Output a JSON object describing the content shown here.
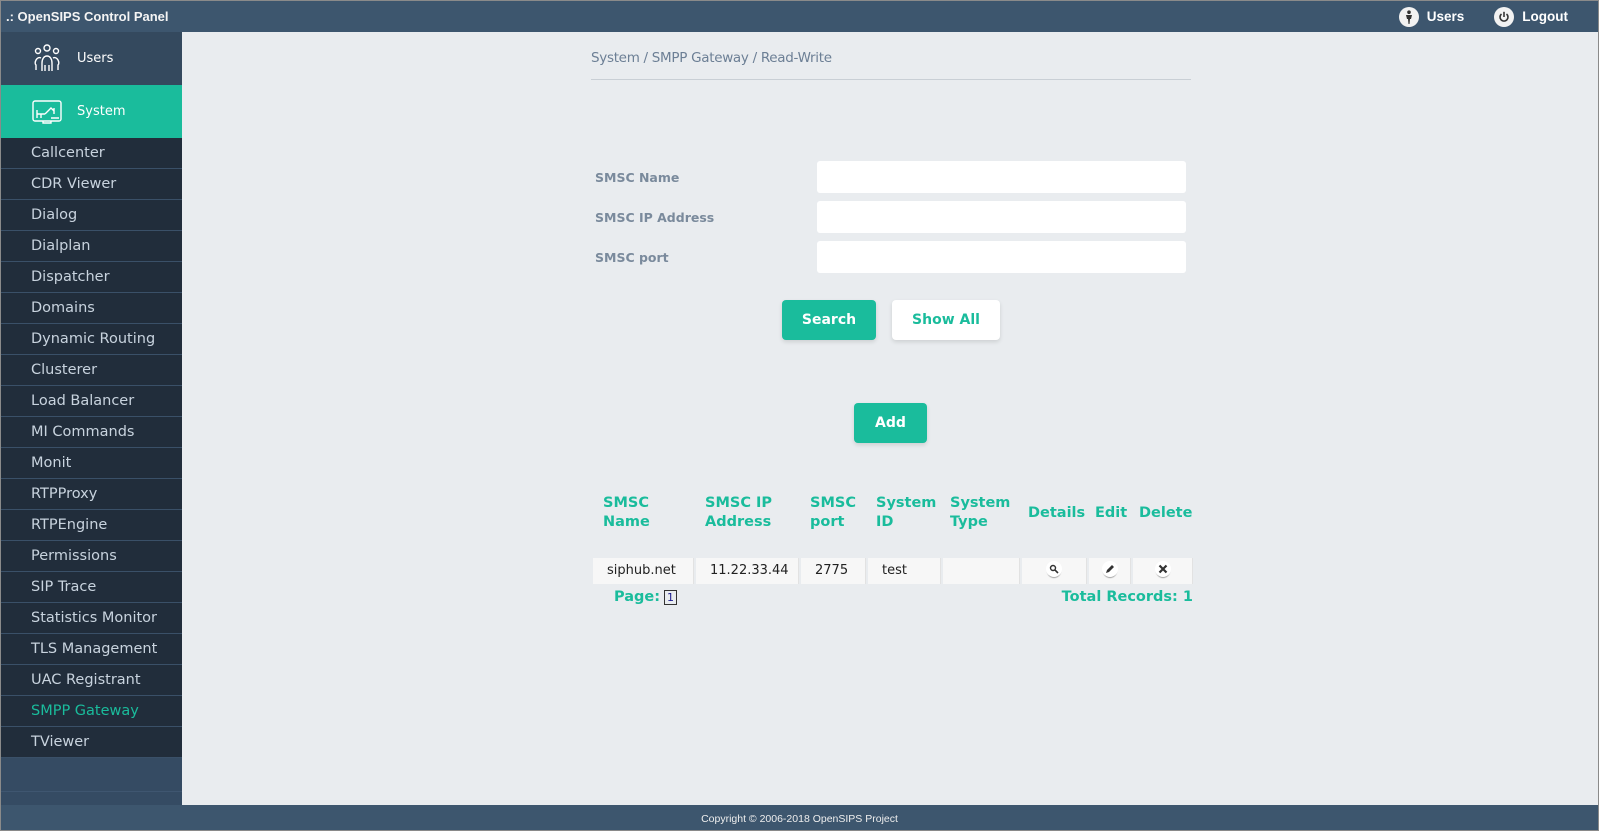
{
  "app": {
    "title": ".: OpenSIPS Control Panel",
    "top_links": [
      {
        "label": "Users",
        "icon": "person-icon"
      },
      {
        "label": "Logout",
        "icon": "power-icon"
      }
    ]
  },
  "sidebar": {
    "sections": [
      {
        "label": "Users",
        "icon": "users-group-icon",
        "active": false
      },
      {
        "label": "System",
        "icon": "system-monitor-icon",
        "active": true
      }
    ],
    "items": [
      {
        "label": "Callcenter"
      },
      {
        "label": "CDR Viewer"
      },
      {
        "label": "Dialog"
      },
      {
        "label": "Dialplan"
      },
      {
        "label": "Dispatcher"
      },
      {
        "label": "Domains"
      },
      {
        "label": "Dynamic Routing"
      },
      {
        "label": "Clusterer"
      },
      {
        "label": "Load Balancer"
      },
      {
        "label": "MI Commands"
      },
      {
        "label": "Monit"
      },
      {
        "label": "RTPProxy"
      },
      {
        "label": "RTPEngine"
      },
      {
        "label": "Permissions"
      },
      {
        "label": "SIP Trace"
      },
      {
        "label": "Statistics Monitor"
      },
      {
        "label": "TLS Management"
      },
      {
        "label": "UAC Registrant"
      },
      {
        "label": "SMPP Gateway",
        "active": true
      },
      {
        "label": "TViewer"
      }
    ]
  },
  "main": {
    "breadcrumb": "System / SMPP Gateway / Read-Write",
    "form": {
      "fields": [
        {
          "label": "SMSC Name",
          "value": "",
          "placeholder": ""
        },
        {
          "label": "SMSC IP Address",
          "value": "",
          "placeholder": ""
        },
        {
          "label": "SMSC port",
          "value": "",
          "placeholder": ""
        }
      ],
      "search_label": "Search",
      "show_all_label": "Show All"
    },
    "add_label": "Add",
    "table": {
      "headers": [
        "SMSC Name",
        "SMSC IP Address",
        "SMSC port",
        "System ID",
        "System Type",
        "Details",
        "Edit",
        "Delete"
      ],
      "rows": [
        {
          "name": "siphub.net",
          "ip": "11.22.33.44",
          "port": "2775",
          "system_id": "test",
          "system_type": ""
        }
      ],
      "page_label": "Page:",
      "page_number": "1",
      "total_label": "Total Records: 1"
    }
  },
  "footer": {
    "copyright": "Copyright © 2006-2018 OpenSIPS Project"
  },
  "colors": {
    "accent": "#1abc9c",
    "topbar": "#3d566e",
    "sidebar_dark": "#212d3b"
  }
}
